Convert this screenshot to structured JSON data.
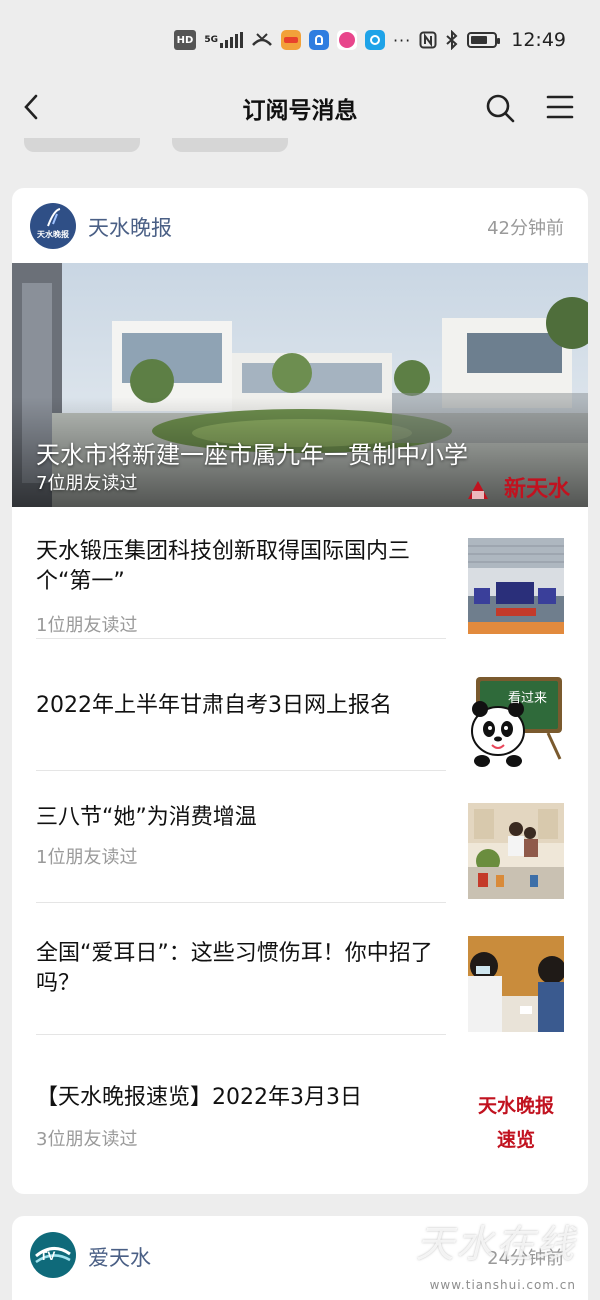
{
  "status_bar": {
    "hd_label": "HD",
    "network_label": "5G",
    "dots": "···",
    "time": "12:49",
    "icons": [
      "hd-icon",
      "signal-icon",
      "missed-call-icon",
      "app-red-icon",
      "app-blue-icon",
      "app-pink-icon",
      "app-search-icon",
      "nfc-icon",
      "bluetooth-icon",
      "battery-icon"
    ],
    "battery_level": 0.6
  },
  "nav": {
    "title": "订阅号消息",
    "icons": [
      "back-icon",
      "search-icon",
      "menu-icon"
    ]
  },
  "card": {
    "source_name": "天水晚报",
    "avatar_text": "天水晚报",
    "time": "42分钟前",
    "hero": {
      "title": "天水市将新建一座市属九年一贯制中小学",
      "readers": "7位朋友读过",
      "logo_text": "新天水"
    },
    "articles": [
      {
        "title": "天水锻压集团科技创新取得国际国内三个“第一”",
        "readers": "1位朋友读过",
        "thumb": "factory-expo-photo"
      },
      {
        "title": "2022年上半年甘肃自考3日网上报名",
        "readers": "",
        "thumb": "panda-blackboard-illustration",
        "thumb_text": "看过来"
      },
      {
        "title": "三八节“她”为消费增温",
        "readers": "1位朋友读过",
        "thumb": "shop-counter-photo"
      },
      {
        "title": "全国“爱耳日”：这些习惯伤耳！你中招了吗？",
        "readers": "",
        "thumb": "ear-checkup-photo"
      },
      {
        "title": "【天水晚报速览】2022年3月3日",
        "readers": "3位朋友读过",
        "thumb": "text-thumb",
        "thumb_line1": "天水晚报",
        "thumb_line2": "速览"
      }
    ]
  },
  "card2": {
    "source_name": "爱天水",
    "time": "24分钟前"
  },
  "watermark": {
    "text": "天水在线",
    "url": "www.tianshui.com.cn"
  },
  "colors": {
    "background": "#ededed",
    "card": "#ffffff",
    "source_name": "#4a5f85",
    "muted": "#9a9a9a",
    "accent_red": "#c1121f"
  }
}
